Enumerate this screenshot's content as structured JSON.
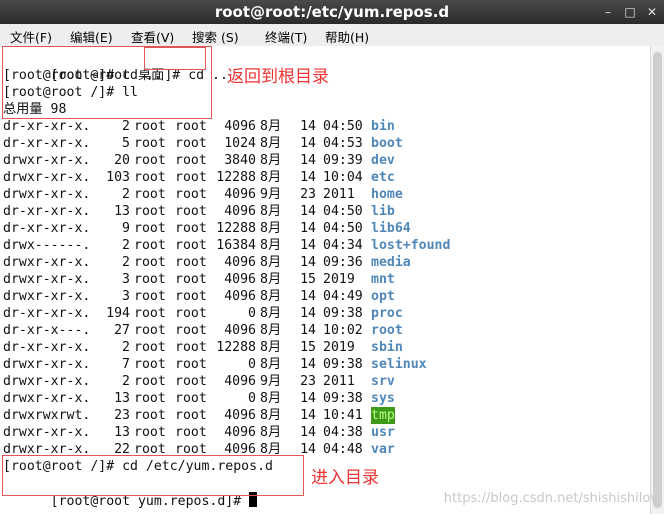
{
  "window": {
    "title": "root@root:/etc/yum.repos.d",
    "buttons": {
      "minimize": "–",
      "maximize": "□",
      "close": "✕"
    }
  },
  "menu": [
    "文件(F)",
    "编辑(E)",
    "查看(V)",
    "搜索 (S)",
    "终端(T)",
    "帮助(H)"
  ],
  "session": {
    "cmd1_prompt": "[root@root 桌面]#",
    "cmd1_cmd": "cd ..",
    "cmd2": "[root@root ~]# cd ..",
    "cmd3": "[root@root /]# ll",
    "total": "总用量 98",
    "cmd4": "[root@root /]# cd /etc/yum.repos.d",
    "cmd5_prompt": "[root@root yum.repos.d]#"
  },
  "listing": [
    {
      "perm": "dr-xr-xr-x.",
      "links": "2",
      "owner": "root",
      "group": "root",
      "size": "4096",
      "month": "8月",
      "day": "14",
      "time": "04:50",
      "name": "bin"
    },
    {
      "perm": "dr-xr-xr-x.",
      "links": "5",
      "owner": "root",
      "group": "root",
      "size": "1024",
      "month": "8月",
      "day": "14",
      "time": "04:53",
      "name": "boot"
    },
    {
      "perm": "drwxr-xr-x.",
      "links": "20",
      "owner": "root",
      "group": "root",
      "size": "3840",
      "month": "8月",
      "day": "14",
      "time": "09:39",
      "name": "dev"
    },
    {
      "perm": "drwxr-xr-x.",
      "links": "103",
      "owner": "root",
      "group": "root",
      "size": "12288",
      "month": "8月",
      "day": "14",
      "time": "10:04",
      "name": "etc"
    },
    {
      "perm": "drwxr-xr-x.",
      "links": "2",
      "owner": "root",
      "group": "root",
      "size": "4096",
      "month": "9月",
      "day": "23",
      "time": "2011",
      "name": "home"
    },
    {
      "perm": "dr-xr-xr-x.",
      "links": "13",
      "owner": "root",
      "group": "root",
      "size": "4096",
      "month": "8月",
      "day": "14",
      "time": "04:50",
      "name": "lib"
    },
    {
      "perm": "dr-xr-xr-x.",
      "links": "9",
      "owner": "root",
      "group": "root",
      "size": "12288",
      "month": "8月",
      "day": "14",
      "time": "04:50",
      "name": "lib64"
    },
    {
      "perm": "drwx------.",
      "links": "2",
      "owner": "root",
      "group": "root",
      "size": "16384",
      "month": "8月",
      "day": "14",
      "time": "04:34",
      "name": "lost+found"
    },
    {
      "perm": "drwxr-xr-x.",
      "links": "2",
      "owner": "root",
      "group": "root",
      "size": "4096",
      "month": "8月",
      "day": "14",
      "time": "09:36",
      "name": "media"
    },
    {
      "perm": "drwxr-xr-x.",
      "links": "3",
      "owner": "root",
      "group": "root",
      "size": "4096",
      "month": "8月",
      "day": "15",
      "time": "2019",
      "name": "mnt"
    },
    {
      "perm": "drwxr-xr-x.",
      "links": "3",
      "owner": "root",
      "group": "root",
      "size": "4096",
      "month": "8月",
      "day": "14",
      "time": "04:49",
      "name": "opt"
    },
    {
      "perm": "dr-xr-xr-x.",
      "links": "194",
      "owner": "root",
      "group": "root",
      "size": "0",
      "month": "8月",
      "day": "14",
      "time": "09:38",
      "name": "proc"
    },
    {
      "perm": "dr-xr-x---.",
      "links": "27",
      "owner": "root",
      "group": "root",
      "size": "4096",
      "month": "8月",
      "day": "14",
      "time": "10:02",
      "name": "root"
    },
    {
      "perm": "dr-xr-xr-x.",
      "links": "2",
      "owner": "root",
      "group": "root",
      "size": "12288",
      "month": "8月",
      "day": "15",
      "time": "2019",
      "name": "sbin"
    },
    {
      "perm": "drwxr-xr-x.",
      "links": "7",
      "owner": "root",
      "group": "root",
      "size": "0",
      "month": "8月",
      "day": "14",
      "time": "09:38",
      "name": "selinux"
    },
    {
      "perm": "drwxr-xr-x.",
      "links": "2",
      "owner": "root",
      "group": "root",
      "size": "4096",
      "month": "9月",
      "day": "23",
      "time": "2011",
      "name": "srv"
    },
    {
      "perm": "drwxr-xr-x.",
      "links": "13",
      "owner": "root",
      "group": "root",
      "size": "0",
      "month": "8月",
      "day": "14",
      "time": "09:38",
      "name": "sys"
    },
    {
      "perm": "drwxrwxrwt.",
      "links": "23",
      "owner": "root",
      "group": "root",
      "size": "4096",
      "month": "8月",
      "day": "14",
      "time": "10:41",
      "name": "tmp"
    },
    {
      "perm": "drwxr-xr-x.",
      "links": "13",
      "owner": "root",
      "group": "root",
      "size": "4096",
      "month": "8月",
      "day": "14",
      "time": "04:38",
      "name": "usr"
    },
    {
      "perm": "drwxr-xr-x.",
      "links": "22",
      "owner": "root",
      "group": "root",
      "size": "4096",
      "month": "8月",
      "day": "14",
      "time": "04:48",
      "name": "var"
    }
  ],
  "annotations": {
    "back_to_root": "返回到根目录",
    "enter_dir": "进入目录",
    "watermark": "https://blog.csdn.net/shishishilov"
  },
  "colors": {
    "dir": "#4f87b8",
    "tmp_bg": "#3c9a18",
    "annotation": "#e33333"
  }
}
